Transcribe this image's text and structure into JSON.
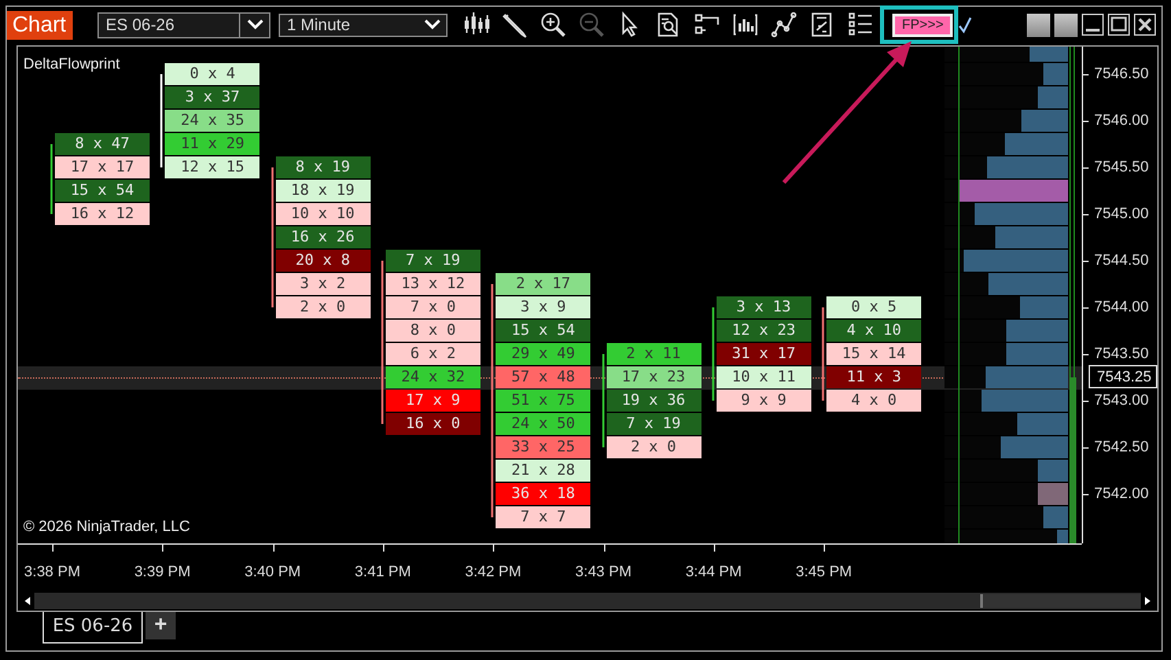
{
  "window": {
    "title": "Chart"
  },
  "toolbar": {
    "instrument": "ES 06-26",
    "interval": "1 Minute",
    "fp_button": {
      "label": "FP>>>",
      "highlighted": true
    }
  },
  "chart": {
    "indicator": "DeltaFlowprint",
    "copyright": "© 2026 NinjaTrader, LLC",
    "current_price": "7543.25",
    "price_axis": [
      "7546.50",
      "7546.00",
      "7545.50",
      "7545.00",
      "7544.50",
      "7544.00",
      "7543.50",
      "7543.00",
      "7542.50",
      "7542.00"
    ],
    "time_axis": [
      "3:38 PM",
      "3:39 PM",
      "3:40 PM",
      "3:41 PM",
      "3:42 PM",
      "3:43 PM",
      "3:44 PM",
      "3:45 PM"
    ],
    "bars": [
      {
        "color": "#33cc33",
        "cells": [
          null,
          null,
          null,
          null,
          {
            "text": "8 x 47",
            "color": "#1e641e"
          },
          {
            "text": "17 x 17",
            "color": "#ffcccc"
          },
          {
            "text": "15 x 54",
            "color": "#1e641e"
          },
          {
            "text": "16 x 12",
            "color": "#ffcccc"
          }
        ]
      },
      {
        "color": "#ffffff",
        "cells": [
          null,
          {
            "text": "0 x 4",
            "color": "#d4f5d4"
          },
          {
            "text": "3 x 37",
            "color": "#1e641e"
          },
          {
            "text": "24 x 35",
            "color": "#88dd88"
          },
          {
            "text": "11 x 29",
            "color": "#33cc33"
          },
          {
            "text": "12 x 15",
            "color": "#d4f5d4"
          }
        ]
      },
      {
        "color": "#f07070",
        "cells": [
          null,
          null,
          null,
          null,
          null,
          {
            "text": "8 x 19",
            "color": "#1e641e"
          },
          {
            "text": "18 x 19",
            "color": "#d4f5d4"
          },
          {
            "text": "10 x 10",
            "color": "#ffcccc"
          },
          {
            "text": "16 x 26",
            "color": "#1e641e"
          },
          {
            "text": "20 x 8",
            "color": "#800000"
          },
          {
            "text": "3 x 2",
            "color": "#ffcccc"
          },
          {
            "text": "2 x 0",
            "color": "#ffcccc"
          }
        ]
      },
      {
        "color": "#f07070",
        "cells": [
          null,
          null,
          null,
          null,
          null,
          null,
          null,
          null,
          null,
          {
            "text": "7 x 19",
            "color": "#1e641e"
          },
          {
            "text": "13 x 12",
            "color": "#ffcccc"
          },
          {
            "text": "7 x 0",
            "color": "#ffcccc"
          },
          {
            "text": "8 x 0",
            "color": "#ffcccc"
          },
          {
            "text": "6 x 2",
            "color": "#ffcccc"
          },
          {
            "text": "24 x 32",
            "color": "#33cc33"
          },
          {
            "text": "17 x 9",
            "color": "#ff0000"
          },
          {
            "text": "16 x 0",
            "color": "#800000"
          }
        ]
      },
      {
        "color": "#f07070",
        "cells": [
          null,
          null,
          null,
          null,
          null,
          null,
          null,
          null,
          null,
          null,
          {
            "text": "2 x 17",
            "color": "#88dd88"
          },
          {
            "text": "3 x 9",
            "color": "#d4f5d4"
          },
          {
            "text": "15 x 54",
            "color": "#1e641e"
          },
          {
            "text": "29 x 49",
            "color": "#33cc33"
          },
          {
            "text": "57 x 48",
            "color": "#ff6666"
          },
          {
            "text": "51 x 75",
            "color": "#33cc33"
          },
          {
            "text": "24 x 50",
            "color": "#33cc33"
          },
          {
            "text": "33 x 25",
            "color": "#ff6666"
          },
          {
            "text": "21 x 28",
            "color": "#d4f5d4"
          },
          {
            "text": "36 x 18",
            "color": "#ff0000"
          },
          {
            "text": "7 x 7",
            "color": "#ffcccc"
          }
        ]
      },
      {
        "color": "#33cc33",
        "cells": [
          null,
          null,
          null,
          null,
          null,
          null,
          null,
          null,
          null,
          null,
          null,
          null,
          null,
          {
            "text": "2 x 11",
            "color": "#33cc33"
          },
          {
            "text": "17 x 23",
            "color": "#88dd88"
          },
          {
            "text": "19 x 36",
            "color": "#1e641e"
          },
          {
            "text": "7 x 19",
            "color": "#1e641e"
          },
          {
            "text": "2 x 0",
            "color": "#ffcccc"
          }
        ]
      },
      {
        "color": "#33cc33",
        "cells": [
          null,
          null,
          null,
          null,
          null,
          null,
          null,
          null,
          null,
          null,
          null,
          {
            "text": "3 x 13",
            "color": "#1e641e"
          },
          {
            "text": "12 x 23",
            "color": "#1e641e"
          },
          {
            "text": "31 x 17",
            "color": "#800000"
          },
          {
            "text": "10 x 11",
            "color": "#d4f5d4"
          },
          {
            "text": "9 x 9",
            "color": "#ffcccc"
          }
        ]
      },
      {
        "color": "#f07070",
        "cells": [
          null,
          null,
          null,
          null,
          null,
          null,
          null,
          null,
          null,
          null,
          null,
          {
            "text": "0 x 5",
            "color": "#d4f5d4"
          },
          {
            "text": "4 x 10",
            "color": "#1e641e"
          },
          {
            "text": "15 x 14",
            "color": "#ffcccc"
          },
          {
            "text": "11 x 3",
            "color": "#800000"
          },
          {
            "text": "4 x 0",
            "color": "#ffcccc"
          }
        ]
      }
    ],
    "volume_profile": [
      {
        "level": 0.31,
        "color": "#35607f",
        "current": false
      },
      {
        "level": 0.2,
        "color": "#35607f",
        "current": false
      },
      {
        "level": 0.25,
        "color": "#35607f",
        "current": false
      },
      {
        "level": 0.38,
        "color": "#35607f",
        "current": false
      },
      {
        "level": 0.51,
        "color": "#35607f",
        "current": false
      },
      {
        "level": 0.66,
        "color": "#35607f",
        "current": false
      },
      {
        "level": 0.88,
        "color": "#a45ca8",
        "current": false
      },
      {
        "level": 0.76,
        "color": "#35607f",
        "current": false
      },
      {
        "level": 0.59,
        "color": "#35607f",
        "current": false
      },
      {
        "level": 0.85,
        "color": "#35607f",
        "current": false
      },
      {
        "level": 0.64,
        "color": "#35607f",
        "current": false
      },
      {
        "level": 0.39,
        "color": "#35607f",
        "current": false
      },
      {
        "level": 0.5,
        "color": "#35607f",
        "current": false
      },
      {
        "level": 0.5,
        "color": "#35607f",
        "current": false
      },
      {
        "level": 0.67,
        "color": "#35607f",
        "current": true
      },
      {
        "level": 0.7,
        "color": "#35607f",
        "current": false
      },
      {
        "level": 0.41,
        "color": "#35607f",
        "current": false
      },
      {
        "level": 0.54,
        "color": "#35607f",
        "current": false
      },
      {
        "level": 0.25,
        "color": "#35607f",
        "current": false
      },
      {
        "level": 0.25,
        "color": "#806878",
        "current": false
      },
      {
        "level": 0.2,
        "color": "#35607f",
        "current": false
      },
      {
        "level": 0.09,
        "color": "#35607f",
        "current": false
      }
    ]
  },
  "tabs": [
    {
      "label": "ES 06-26",
      "selected": true
    }
  ],
  "add_tab": "+"
}
